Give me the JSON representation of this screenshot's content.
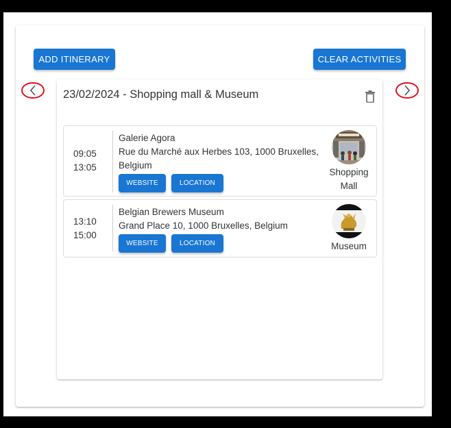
{
  "toolbar": {
    "add_itinerary_label": "ADD ITINERARY",
    "clear_activities_label": "CLEAR ACTIVITIES"
  },
  "day": {
    "title": "23/02/2024 - Shopping mall & Museum",
    "activities": [
      {
        "start": "09:05",
        "end": "13:05",
        "name": "Galerie Agora",
        "address": "Rue du Marché aux Herbes 103, 1000 Bruxelles, Belgium",
        "website_label": "WEBSITE",
        "location_label": "LOCATION",
        "category": "Shopping Mall",
        "thumbnail": "shopping-mall-photo"
      },
      {
        "start": "13:10",
        "end": "15:00",
        "name": "Belgian Brewers Museum",
        "address": "Grand Place 10, 1000 Bruxelles, Belgium",
        "website_label": "WEBSITE",
        "location_label": "LOCATION",
        "category": "Museum",
        "thumbnail": "museum-golden-statue-photo"
      }
    ]
  },
  "navigation": {
    "prev_icon": "chevron-left-icon",
    "next_icon": "chevron-right-icon",
    "delete_icon": "trash-icon"
  },
  "colors": {
    "primary": "#1976d2",
    "highlight_circle": "#e0101a",
    "background_outer": "#000000",
    "text": "#333333"
  }
}
